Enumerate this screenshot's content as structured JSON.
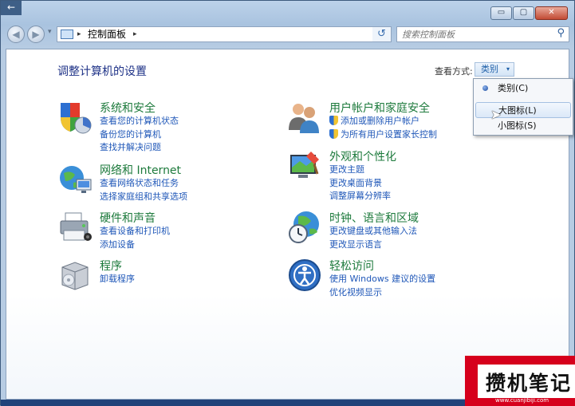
{
  "window": {
    "back_arrow": "←",
    "caption_buttons": [
      "▭",
      "▢",
      "✕"
    ]
  },
  "navbar": {
    "back_glyph": "◀",
    "forward_glyph": "▶",
    "breadcrumb_sep": "▸",
    "breadcrumb": "控制面板",
    "dropdown_glyph": "▾",
    "refresh_glyph": "↺",
    "search_placeholder": "搜索控制面板",
    "search_glyph": "⚲"
  },
  "content": {
    "heading": "调整计算机的设置",
    "view_label": "查看方式:",
    "view_value": "类别",
    "view_arrow": "▾",
    "categories": [
      {
        "title": "系统和安全",
        "links": [
          "查看您的计算机状态",
          "备份您的计算机",
          "查找并解决问题"
        ]
      },
      {
        "title": "网络和 Internet",
        "links": [
          "查看网络状态和任务",
          "选择家庭组和共享选项"
        ]
      },
      {
        "title": "硬件和声音",
        "links": [
          "查看设备和打印机",
          "添加设备"
        ]
      },
      {
        "title": "程序",
        "links": [
          "卸载程序"
        ]
      },
      {
        "title": "用户帐户和家庭安全",
        "links": [
          "添加或删除用户帐户",
          "为所有用户设置家长控制"
        ]
      },
      {
        "title": "外观和个性化",
        "links": [
          "更改主题",
          "更改桌面背景",
          "调整屏幕分辨率"
        ]
      },
      {
        "title": "时钟、语言和区域",
        "links": [
          "更改键盘或其他输入法",
          "更改显示语言"
        ]
      },
      {
        "title": "轻松访问",
        "links": [
          "使用 Windows 建议的设置",
          "优化视频显示"
        ]
      }
    ]
  },
  "view_menu": {
    "items": [
      "类别(C)",
      "大图标(L)",
      "小图标(S)"
    ],
    "selected": "类别(C)",
    "hovered": "大图标(L)"
  },
  "watermark": {
    "text": "攒机笔记",
    "url": "www.cuanjibiji.com"
  },
  "colors": {
    "link": "#1f57b8",
    "category_title": "#1d7a3c",
    "heading": "#1e3287"
  }
}
